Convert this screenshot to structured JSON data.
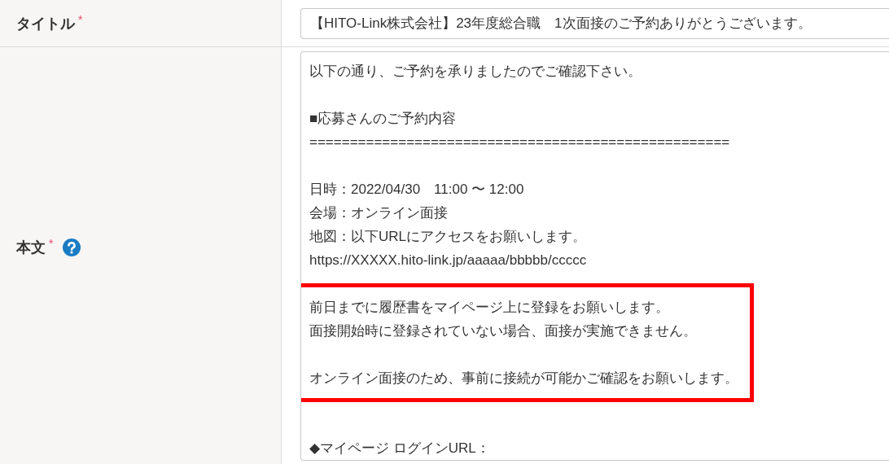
{
  "title_field": {
    "label": "タイトル",
    "required_mark": "*",
    "value": "【HITO-Link株式会社】23年度総合職　1次面接のご予約ありがとうございます。"
  },
  "body_field": {
    "label": "本文",
    "required_mark": "*",
    "segments": [
      {
        "highlighted": false,
        "blocks": [
          [
            "以下の通り、ご予約を承りましたのでご確認下さい。"
          ],
          [
            "■応募さんのご予約内容",
            "===================================================="
          ],
          [
            "日時：2022/04/30　11:00 〜 12:00",
            "会場：オンライン面接",
            "地図：以下URLにアクセスをお願いします。",
            "https://XXXXX.hito-link.jp/aaaaa/bbbbb/ccccc"
          ]
        ]
      },
      {
        "highlighted": true,
        "blocks": [
          [
            "前日までに履歴書をマイページ上に登録をお願いします。",
            "面接開始時に登録されていない場合、面接が実施できません。"
          ],
          [
            "オンライン面接のため、事前に接続が可能かご確認をお願いします。"
          ]
        ]
      },
      {
        "highlighted": false,
        "blocks": [
          [
            "◆マイページ ログインURL："
          ]
        ]
      }
    ]
  }
}
